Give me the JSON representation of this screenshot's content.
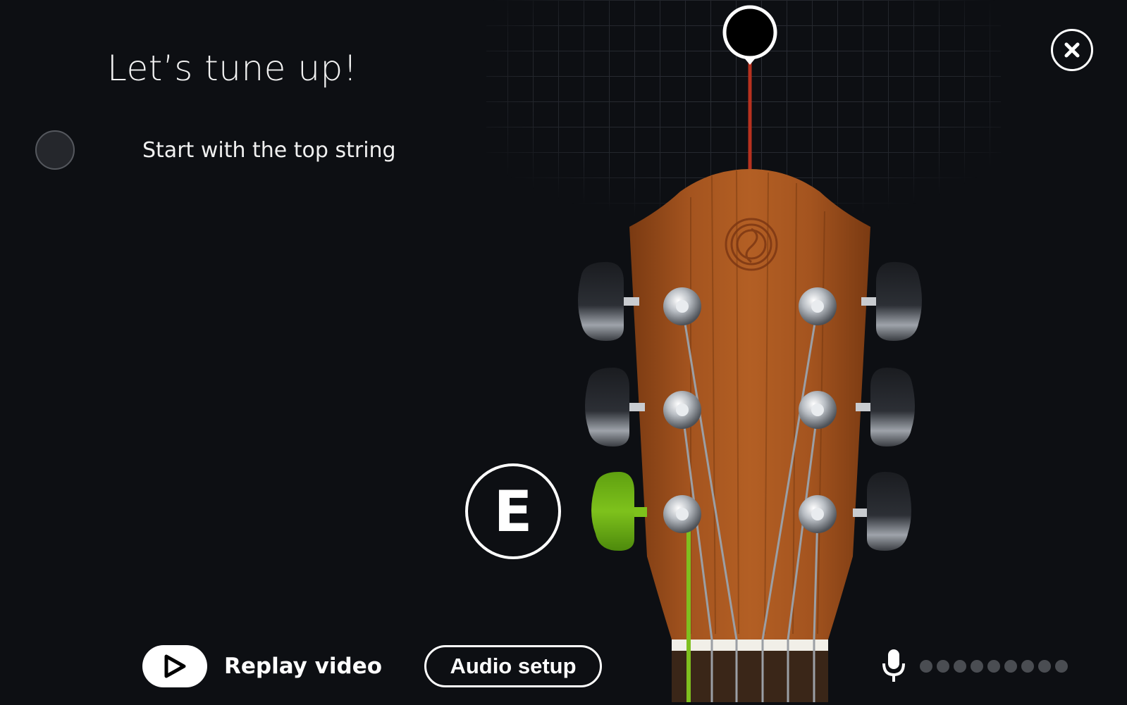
{
  "header": {
    "title": "Let’s tune up!"
  },
  "step": {
    "text": "Start with the top string"
  },
  "tuner": {
    "current_note": "E"
  },
  "controls": {
    "replay_label": "Replay video",
    "audio_setup_label": "Audio setup"
  },
  "mic": {
    "level_dots": 9,
    "level_active": 0
  },
  "colors": {
    "background": "#0d0f13",
    "headstock": "#a0501d",
    "active_string": "#7fbf1f",
    "pitch_line": "#b8311f",
    "inactive_dot": "#4a4d52"
  }
}
